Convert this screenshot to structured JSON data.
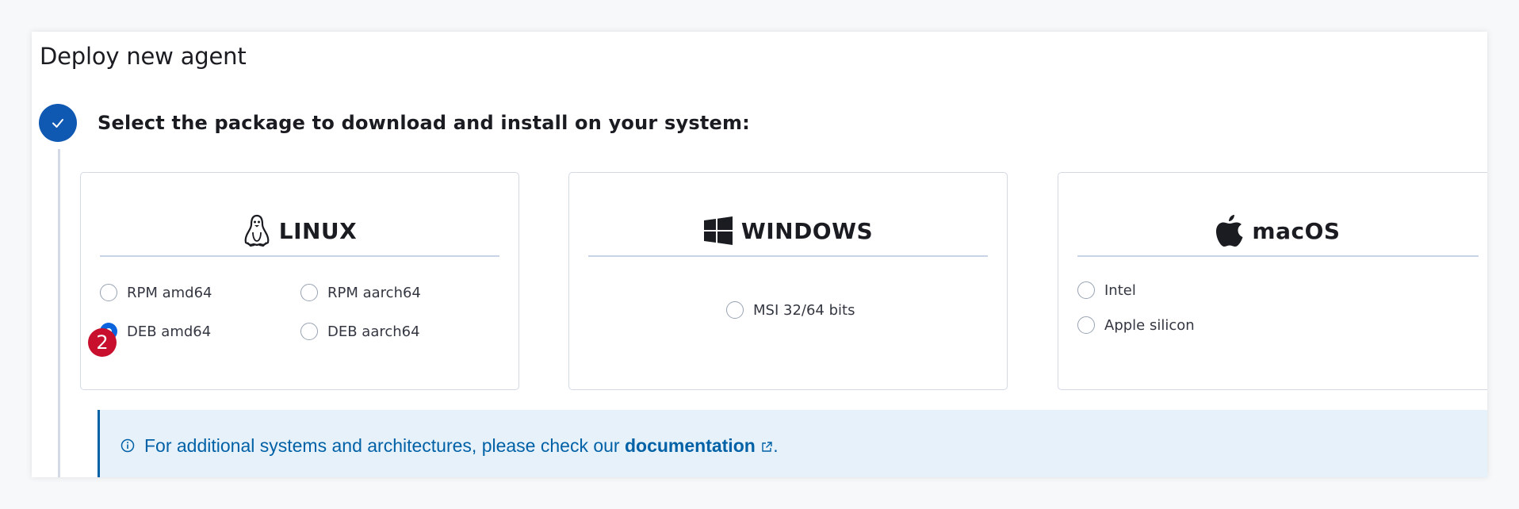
{
  "page": {
    "title": "Deploy new agent"
  },
  "step": {
    "title": "Select the package to download and install on your system:",
    "status": "complete"
  },
  "platforms": {
    "linux": {
      "title": "LINUX",
      "icon": "linux-penguin-icon",
      "options": [
        {
          "label": "RPM amd64",
          "checked": false
        },
        {
          "label": "RPM aarch64",
          "checked": false
        },
        {
          "label": "DEB amd64",
          "checked": true
        },
        {
          "label": "DEB aarch64",
          "checked": false
        }
      ]
    },
    "windows": {
      "title": "WINDOWS",
      "icon": "windows-logo-icon",
      "options": [
        {
          "label": "MSI 32/64 bits",
          "checked": false
        }
      ]
    },
    "macos": {
      "title": "macOS",
      "icon": "apple-logo-icon",
      "options": [
        {
          "label": "Intel",
          "checked": false
        },
        {
          "label": "Apple silicon",
          "checked": false
        }
      ]
    }
  },
  "annotation": {
    "badge": "2"
  },
  "callout": {
    "text_before": "For additional systems and architectures, please check our ",
    "link_text": "documentation",
    "text_after": "."
  },
  "colors": {
    "primary": "#0b64dd",
    "step_complete": "#1059b3",
    "badge": "#c8102e",
    "callout_bg": "#e6f1fa",
    "callout_text": "#0061a6"
  }
}
